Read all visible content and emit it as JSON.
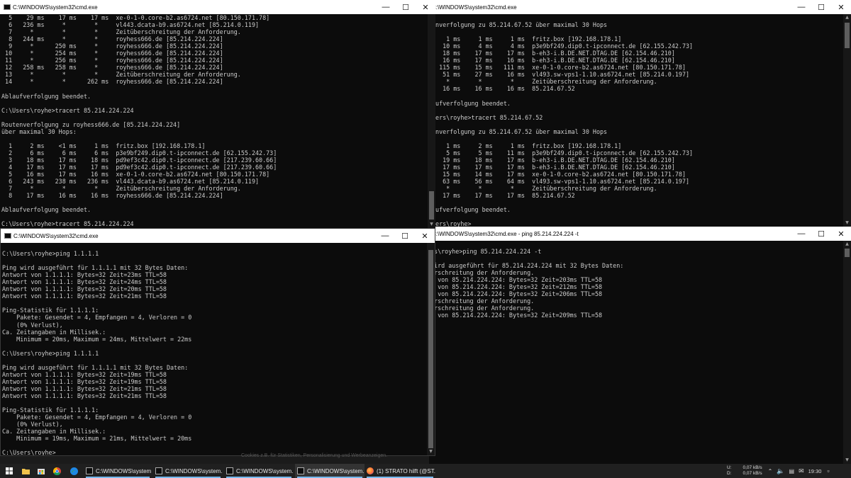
{
  "windows": {
    "top_left": {
      "title": "C:\\WINDOWS\\system32\\cmd.exe",
      "lines": [
        "  5    29 ms    17 ms    17 ms  xe-0-1-0.core-b2.as6724.net [80.150.171.78]",
        "  6   236 ms     *        *     vl443.dcata-b9.as6724.net [85.214.0.119]",
        "  7     *        *        *     Zeitüberschreitung der Anforderung.",
        "  8   244 ms     *        *     royhess666.de [85.214.224.224]",
        "  9     *      250 ms     *     royhess666.de [85.214.224.224]",
        " 10     *      254 ms     *     royhess666.de [85.214.224.224]",
        " 11     *      256 ms     *     royhess666.de [85.214.224.224]",
        " 12   258 ms   258 ms     *     royhess666.de [85.214.224.224]",
        " 13     *        *        *     Zeitüberschreitung der Anforderung.",
        " 14     *        *      262 ms  royhess666.de [85.214.224.224]",
        "",
        "Ablaufverfolgung beendet.",
        "",
        "C:\\Users\\royhe>tracert 85.214.224.224",
        "",
        "Routenverfolgung zu royhess666.de [85.214.224.224]",
        "über maximal 30 Hops:",
        "",
        "  1     2 ms    <1 ms     1 ms  fritz.box [192.168.178.1]",
        "  2     6 ms     6 ms     6 ms  p3e9bf249.dip0.t-ipconnect.de [62.155.242.73]",
        "  3    18 ms    17 ms    18 ms  pd9ef3c42.dip0.t-ipconnect.de [217.239.60.66]",
        "  4    17 ms    17 ms    17 ms  pd9ef3c42.dip0.t-ipconnect.de [217.239.60.66]",
        "  5    16 ms    17 ms    16 ms  xe-0-1-0.core-b2.as6724.net [80.150.171.78]",
        "  6   243 ms   238 ms   236 ms  vl443.dcata-b9.as6724.net [85.214.0.119]",
        "  7     *        *        *     Zeitüberschreitung der Anforderung.",
        "  8    17 ms    16 ms    16 ms  royhess666.de [85.214.224.224]",
        "",
        "Ablaufverfolgung beendet.",
        "",
        "C:\\Users\\royhe>tracert 85.214.224.224"
      ]
    },
    "top_right": {
      "title": "C:\\WINDOWS\\system32\\cmd.exe",
      "lines": [
        "enverfolgung zu 85.214.67.52 über maximal 30 Hops",
        "",
        "    1 ms     1 ms     1 ms  fritz.box [192.168.178.1]",
        "   10 ms     4 ms     4 ms  p3e9bf249.dip0.t-ipconnect.de [62.155.242.73]",
        "   18 ms    17 ms    17 ms  b-eh3-i.B.DE.NET.DTAG.DE [62.154.46.210]",
        "   16 ms    17 ms    16 ms  b-eh3-i.B.DE.NET.DTAG.DE [62.154.46.210]",
        "  115 ms    15 ms   111 ms  xe-0-1-0.core-b2.as6724.net [80.150.171.78]",
        "   51 ms    27 ms    16 ms  vl493.sw-vps1-1.10.as6724.net [85.214.0.197]",
        "    *        *        *     Zeitüberschreitung der Anforderung.",
        "   16 ms    16 ms    16 ms  85.214.67.52",
        "",
        "aufverfolgung beendet.",
        "",
        "sers\\royhe>tracert 85.214.67.52",
        "",
        "enverfolgung zu 85.214.67.52 über maximal 30 Hops",
        "",
        "    1 ms     2 ms     1 ms  fritz.box [192.168.178.1]",
        "    5 ms     5 ms    11 ms  p3e9bf249.dip0.t-ipconnect.de [62.155.242.73]",
        "   19 ms    18 ms    17 ms  b-eh3-i.B.DE.NET.DTAG.DE [62.154.46.210]",
        "   17 ms    17 ms    17 ms  b-eh3-i.B.DE.NET.DTAG.DE [62.154.46.210]",
        "   15 ms    14 ms    17 ms  xe-0-1-0.core-b2.as6724.net [80.150.171.78]",
        "   63 ms    56 ms    64 ms  vl493.sw-vps1-1.10.as6724.net [85.214.0.197]",
        "    *        *        *     Zeitüberschreitung der Anforderung.",
        "   17 ms    17 ms    17 ms  85.214.67.52",
        "",
        "aufverfolgung beendet.",
        "",
        "sers\\royhe>"
      ]
    },
    "bottom_left": {
      "title": "C:\\WINDOWS\\system32\\cmd.exe",
      "lines": [
        "",
        "C:\\Users\\royhe>ping 1.1.1.1",
        "",
        "Ping wird ausgeführt für 1.1.1.1 mit 32 Bytes Daten:",
        "Antwort von 1.1.1.1: Bytes=32 Zeit=23ms TTL=58",
        "Antwort von 1.1.1.1: Bytes=32 Zeit=24ms TTL=58",
        "Antwort von 1.1.1.1: Bytes=32 Zeit=20ms TTL=58",
        "Antwort von 1.1.1.1: Bytes=32 Zeit=21ms TTL=58",
        "",
        "Ping-Statistik für 1.1.1.1:",
        "    Pakete: Gesendet = 4, Empfangen = 4, Verloren = 0",
        "    (0% Verlust),",
        "Ca. Zeitangaben in Millisek.:",
        "    Minimum = 20ms, Maximum = 24ms, Mittelwert = 22ms",
        "",
        "C:\\Users\\royhe>ping 1.1.1.1",
        "",
        "Ping wird ausgeführt für 1.1.1.1 mit 32 Bytes Daten:",
        "Antwort von 1.1.1.1: Bytes=32 Zeit=19ms TTL=58",
        "Antwort von 1.1.1.1: Bytes=32 Zeit=19ms TTL=58",
        "Antwort von 1.1.1.1: Bytes=32 Zeit=21ms TTL=58",
        "Antwort von 1.1.1.1: Bytes=32 Zeit=21ms TTL=58",
        "",
        "Ping-Statistik für 1.1.1.1:",
        "    Pakete: Gesendet = 4, Empfangen = 4, Verloren = 0",
        "    (0% Verlust),",
        "Ca. Zeitangaben in Millisek.:",
        "    Minimum = 19ms, Maximum = 21ms, Mittelwert = 20ms",
        "",
        "C:\\Users\\royhe>"
      ]
    },
    "bottom_right": {
      "title": "C:\\WINDOWS\\system32\\cmd.exe - ping  85.214.224.224 -t",
      "lines": [
        "",
        "rs\\royhe>ping 85.214.224.224 -t",
        "",
        "wird ausgeführt für 85.214.224.224 mit 32 Bytes Daten:",
        "erschreitung der Anforderung.",
        "t von 85.214.224.224: Bytes=32 Zeit=203ms TTL=58",
        "t von 85.214.224.224: Bytes=32 Zeit=212ms TTL=58",
        "t von 85.214.224.224: Bytes=32 Zeit=206ms TTL=58",
        "erschreitung der Anforderung.",
        "erschreitung der Anforderung.",
        "t von 85.214.224.224: Bytes=32 Zeit=209ms TTL=58"
      ]
    }
  },
  "background_text": "Cookies z.B. für Statistiken, Personalisierung und Werbeanzeigen.",
  "taskbar": {
    "items": [
      {
        "label": "C:\\WINDOWS\\system...",
        "icon": "cmd-icon",
        "active": false
      },
      {
        "label": "C:\\WINDOWS\\system...",
        "icon": "cmd-icon",
        "active": false
      },
      {
        "label": "C:\\WINDOWS\\system...",
        "icon": "cmd-icon",
        "active": false
      },
      {
        "label": "C:\\WINDOWS\\system...",
        "icon": "cmd-icon",
        "active": true
      },
      {
        "label": "(1) STRATO hilft (@ST...",
        "icon": "firefox-icon",
        "active": false
      }
    ],
    "network": {
      "upload_label": "U:",
      "download_label": "D:",
      "upload": "0,07 kB/s",
      "download": "0,07 kB/s"
    },
    "clock": "19:30"
  },
  "colors": {
    "terminal_bg": "#0c0c0c",
    "terminal_fg": "#cccccc",
    "titlebar_bg": "#ffffff",
    "taskbar_bg": "#202020",
    "accent": "#76b9ed"
  }
}
